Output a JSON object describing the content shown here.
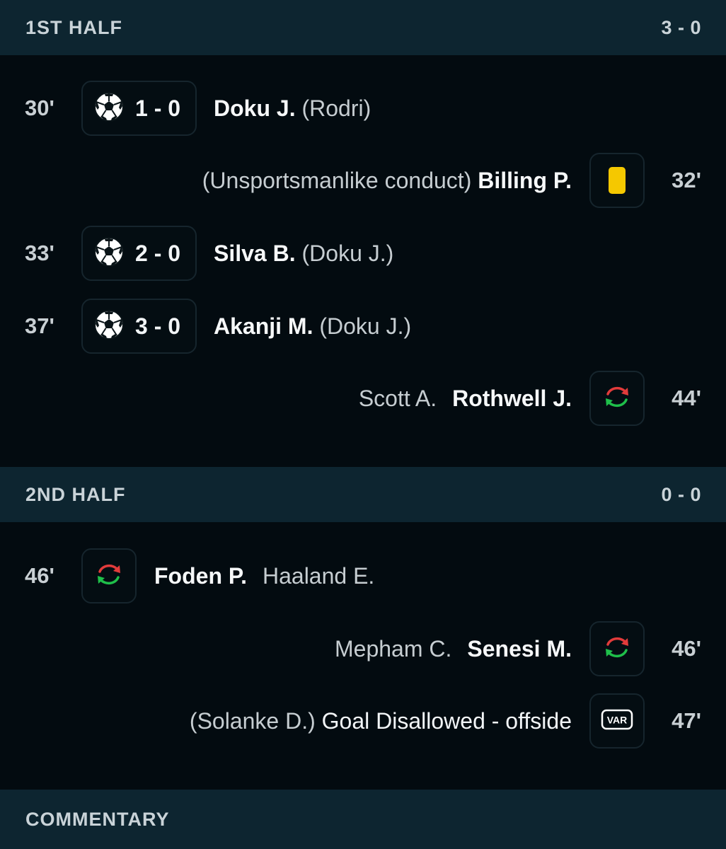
{
  "first_half": {
    "title": "1ST HALF",
    "score": "3 - 0",
    "events": {
      "goal1": {
        "minute": "30'",
        "score": "1 - 0",
        "player": "Doku J.",
        "assist": "(Rodri)"
      },
      "card1": {
        "minute": "32'",
        "reason": "(Unsportsmanlike conduct)",
        "player": "Billing P.",
        "card_color": "#f5c800"
      },
      "goal2": {
        "minute": "33'",
        "score": "2 - 0",
        "player": "Silva B.",
        "assist": "(Doku J.)"
      },
      "goal3": {
        "minute": "37'",
        "score": "3 - 0",
        "player": "Akanji M.",
        "assist": "(Doku J.)"
      },
      "sub1": {
        "minute": "44'",
        "player_out": "Scott A.",
        "player_in": "Rothwell J."
      }
    }
  },
  "second_half": {
    "title": "2ND HALF",
    "score": "0 - 0",
    "events": {
      "sub2": {
        "minute": "46'",
        "player_in": "Foden P.",
        "player_out": "Haaland E."
      },
      "sub3": {
        "minute": "46'",
        "player_out": "Mepham C.",
        "player_in": "Senesi M."
      },
      "var1": {
        "minute": "47'",
        "player": "(Solanke D.)",
        "decision": "Goal Disallowed - offside",
        "icon_label": "VAR"
      }
    }
  },
  "commentary": {
    "title": "COMMENTARY"
  },
  "colors": {
    "substitution_in": "#1fbf4a",
    "substitution_out": "#e23b3b",
    "header_bg": "#0d2530",
    "page_bg": "#030b10"
  }
}
